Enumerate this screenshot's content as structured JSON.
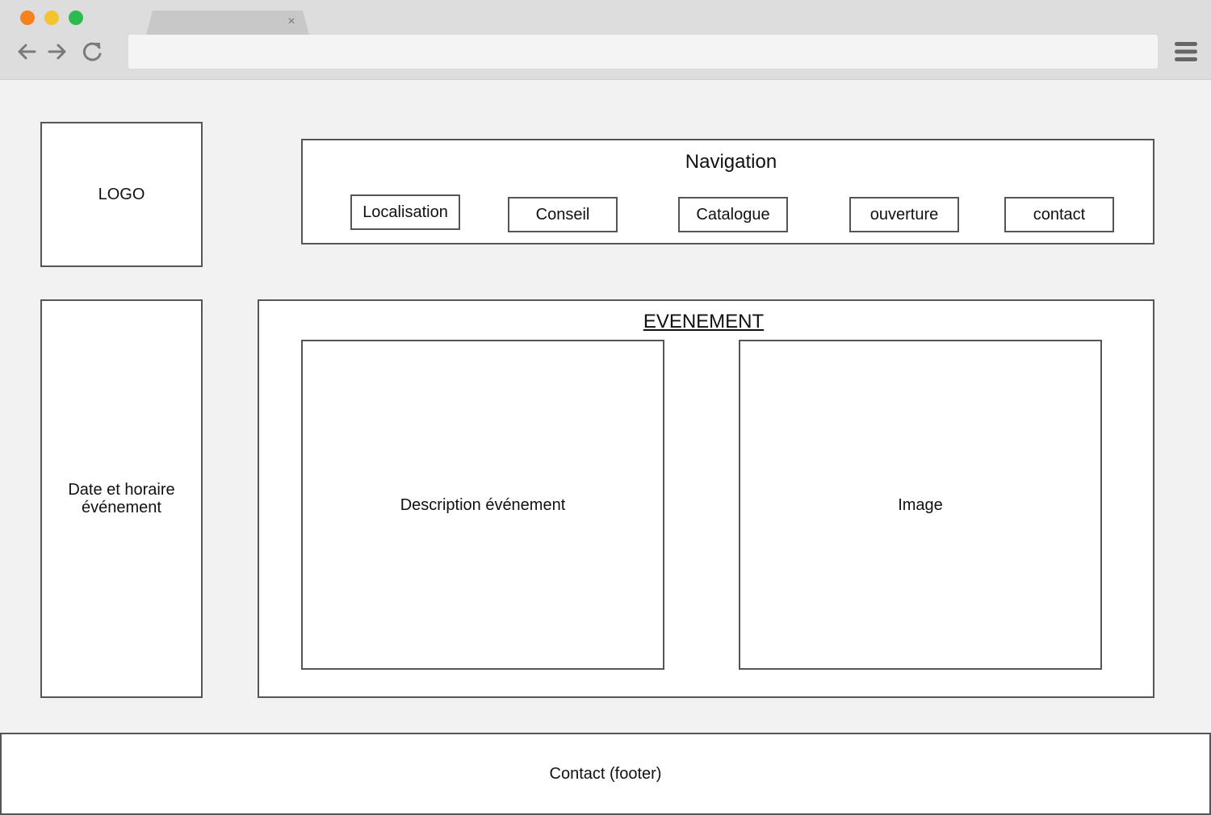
{
  "browser": {
    "tab_title": "",
    "tab_close_glyph": "×",
    "url": "",
    "icons": [
      "back-arrow-icon",
      "forward-arrow-icon",
      "reload-icon",
      "hamburger-menu-icon"
    ]
  },
  "logo": {
    "label": "LOGO"
  },
  "sidebar": {
    "label": "Date et horaire\névénement"
  },
  "navigation": {
    "title": "Navigation",
    "items": [
      {
        "label": "Localisation"
      },
      {
        "label": "Conseil"
      },
      {
        "label": "Catalogue"
      },
      {
        "label": "ouverture"
      },
      {
        "label": "contact"
      }
    ]
  },
  "event": {
    "title": "EVENEMENT",
    "description_label": "Description événement",
    "image_label": "Image"
  },
  "footer": {
    "label": "Contact (footer)"
  },
  "colors": {
    "page_background": "#f2f2f2",
    "chrome_background": "#dddddd",
    "border": "#555555",
    "close_dot": "#f5821f",
    "minimize_dot": "#f4c430",
    "zoom_dot": "#2bbb4f"
  }
}
